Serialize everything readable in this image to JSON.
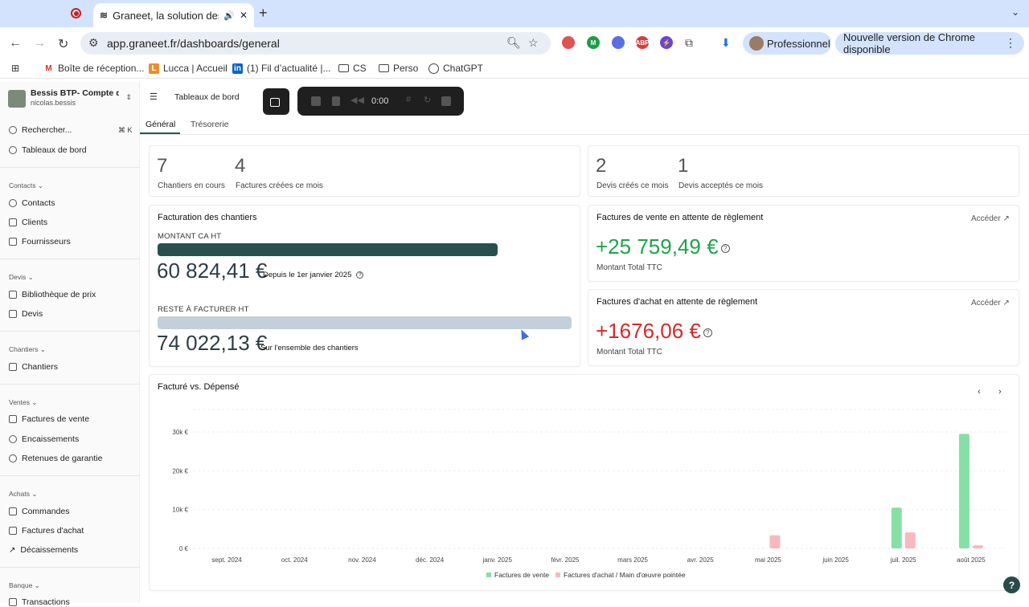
{
  "browser": {
    "tab_title": "Graneet, la solution des m",
    "url": "app.graneet.fr/dashboards/general",
    "profile_label": "Professionnel",
    "update_label": "Nouvelle version de Chrome disponible",
    "bookmarks": [
      {
        "label": "Boîte de réception...",
        "icon": "gmail-icon"
      },
      {
        "label": "Lucca | Accueil",
        "icon": "lucca-icon"
      },
      {
        "label": "(1) Fil d’actualité |...",
        "icon": "linkedin-icon"
      },
      {
        "label": "CS",
        "icon": "folder-icon"
      },
      {
        "label": "Perso",
        "icon": "folder-icon"
      },
      {
        "label": "ChatGPT",
        "icon": "chatgpt-icon"
      }
    ]
  },
  "sidebar": {
    "org_name": "Bessis BTP- Compte d...",
    "org_user": "nicolas.bessis",
    "search_label": "Rechercher...",
    "search_shortcut": "⌘ K",
    "dashboards_label": "Tableaux de bord",
    "sections": {
      "contacts": "Contacts",
      "devis": "Devis",
      "chantiers": "Chantiers",
      "ventes": "Ventes",
      "achats": "Achats",
      "banque": "Banque"
    },
    "items": {
      "contacts": "Contacts",
      "clients": "Clients",
      "fournisseurs": "Fournisseurs",
      "bibliotheque": "Bibliothèque de prix",
      "devis": "Devis",
      "chantiers": "Chantiers",
      "factures_vente": "Factures de vente",
      "encaissements": "Encaissements",
      "retenues": "Retenues de garantie",
      "commandes": "Commandes",
      "factures_achat": "Factures d'achat",
      "decaissements": "Décaissements",
      "transactions": "Transactions"
    }
  },
  "header": {
    "breadcrumb": "Tableaux de bord",
    "recorder_time": "0:00",
    "tabs": [
      "Général",
      "Trésorerie"
    ]
  },
  "kpis": {
    "chantiers_en_cours": {
      "value": "7",
      "label": "Chantiers en cours"
    },
    "factures_mois": {
      "value": "4",
      "label": "Factures créées ce mois"
    },
    "devis_crees": {
      "value": "2",
      "label": "Devis créés ce mois"
    },
    "devis_acceptes": {
      "value": "1",
      "label": "Devis acceptés ce mois"
    }
  },
  "facturation": {
    "title": "Facturation des chantiers",
    "ca_label": "MONTANT CA HT",
    "ca_value": "60 824,41 €",
    "ca_note": "Depuis le 1er janvier 2025",
    "reste_label": "RESTE À FACTURER HT",
    "reste_value": "74 022,13 €",
    "reste_note": "Sur l'ensemble des chantiers"
  },
  "vente_attente": {
    "title": "Factures de vente en attente de règlement",
    "link": "Accéder",
    "amount": "+25 759,49 €",
    "note": "Montant Total TTC",
    "color": "#1fa34a"
  },
  "achat_attente": {
    "title": "Factures d'achat en attente de règlement",
    "link": "Accéder",
    "amount": "+1676,06 €",
    "note": "Montant Total TTC",
    "color": "#d42a2a"
  },
  "chart_title": "Facturé vs. Dépensé",
  "chart_data": {
    "type": "bar",
    "categories": [
      "sept. 2024",
      "oct. 2024",
      "nov. 2024",
      "déc. 2024",
      "janv. 2025",
      "févr. 2025",
      "mars 2025",
      "avr. 2025",
      "mai 2025",
      "juin 2025",
      "juil. 2025",
      "août 2025"
    ],
    "series": [
      {
        "name": "Factures de vente",
        "color": "#86e0a6",
        "values": [
          0,
          0,
          0,
          0,
          0,
          0,
          0,
          0,
          0,
          0,
          10500,
          29500
        ]
      },
      {
        "name": "Factures d'achat / Main d'œuvre pointée",
        "color": "#f9b8be",
        "values": [
          0,
          0,
          0,
          0,
          0,
          0,
          0,
          0,
          3400,
          0,
          4100,
          800
        ]
      }
    ],
    "yticks": [
      "0 €",
      "10k €",
      "20k €",
      "30k €"
    ],
    "ylim": [
      0,
      30000
    ],
    "legend_position": "bottom"
  }
}
